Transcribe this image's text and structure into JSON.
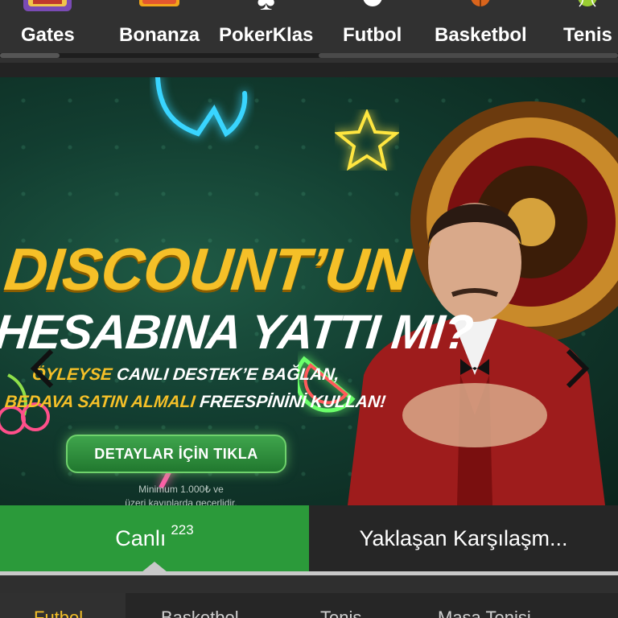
{
  "nav": {
    "items": [
      {
        "label": "Gates",
        "icon": "gates-of-olympus-icon"
      },
      {
        "label": "Bonanza",
        "icon": "bonanza-icon"
      },
      {
        "label": "PokerKlas",
        "icon": "club-suit-icon"
      },
      {
        "label": "Futbol",
        "icon": "soccer-ball-icon"
      },
      {
        "label": "Basketbol",
        "icon": "basketball-icon"
      },
      {
        "label": "Tenis",
        "icon": "tennis-ball-icon"
      }
    ]
  },
  "banner": {
    "headline1": "DISCOUNT’UN",
    "headline2": "HESABINA YATTI MI?",
    "line3_a": "ÖYLEYSE ",
    "line3_b": "CANLI DESTEK’E BAĞLAN,",
    "line4_a": "BEDAVA SATIN ALMALI ",
    "line4_b": "FREESPİNİNİ KULLAN!",
    "cta": "DETAYLAR İÇİN TIKLA",
    "note_line1": "Minimum 1.000₺ ve",
    "note_line2": "üzeri kayıplarda geçerlidir.",
    "prev_icon": "chevron-left-icon",
    "next_icon": "chevron-right-icon"
  },
  "tabs": {
    "live_label": "Canlı",
    "live_count": "223",
    "upcoming_label": "Yaklaşan Karşılaşm..."
  },
  "sports": [
    {
      "label": "Futbol",
      "active": true
    },
    {
      "label": "Basketbol",
      "active": false
    },
    {
      "label": "Tenis",
      "active": false
    },
    {
      "label": "Masa Tenisi",
      "active": false
    }
  ],
  "colors": {
    "accent_green": "#2b9a3a",
    "highlight_yellow": "#f5c028",
    "background_dark": "#262626"
  }
}
